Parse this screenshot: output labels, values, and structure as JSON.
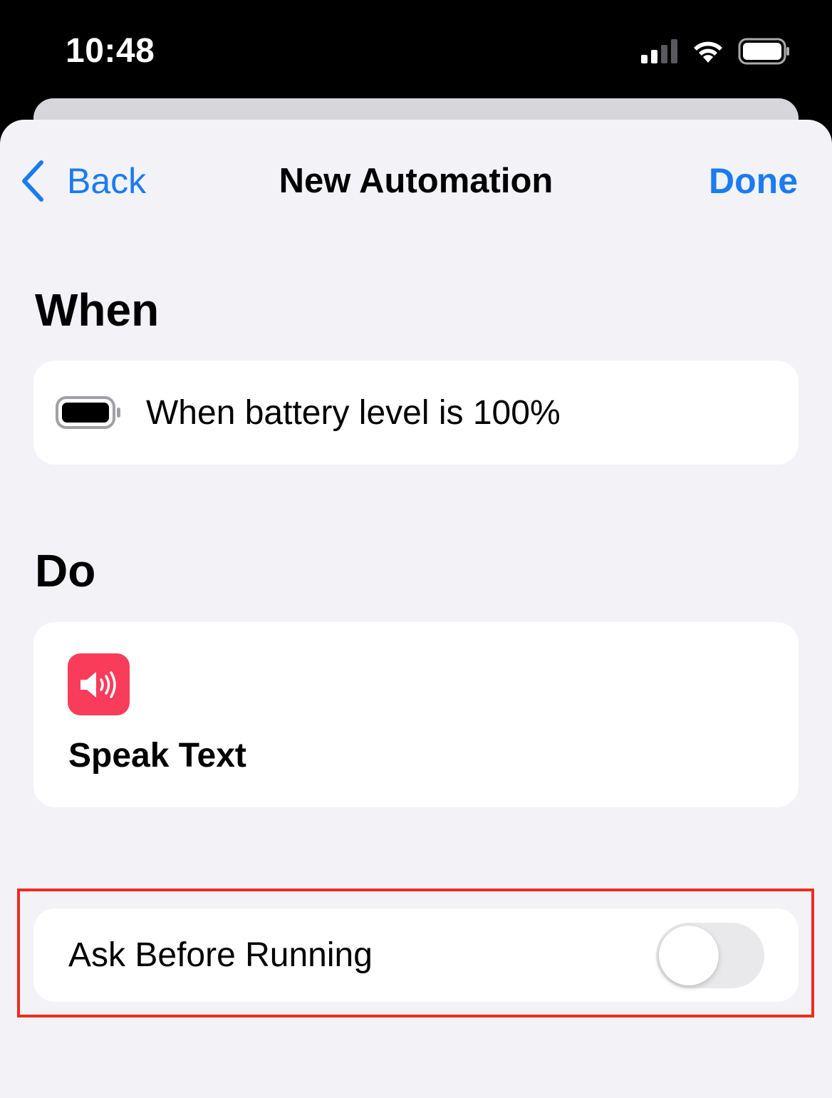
{
  "status_bar": {
    "time": "10:48",
    "signal_icon": "cellular-signal-icon",
    "wifi_icon": "wifi-icon",
    "battery_icon": "battery-icon"
  },
  "nav": {
    "back_label": "Back",
    "back_icon": "chevron-left-icon",
    "title": "New Automation",
    "done_label": "Done"
  },
  "when": {
    "heading": "When",
    "trigger_icon": "battery-full-icon",
    "trigger_text": "When battery level is 100%"
  },
  "do": {
    "heading": "Do",
    "action_icon": "speaker-icon",
    "action_label": "Speak Text"
  },
  "ask_before_running": {
    "label": "Ask Before Running",
    "enabled": false
  },
  "colors": {
    "accent": "#1b7bf0",
    "action_icon_bg": "#f83c5a",
    "highlight_border": "#ef2b1e",
    "sheet_bg": "#f2f2f7"
  }
}
